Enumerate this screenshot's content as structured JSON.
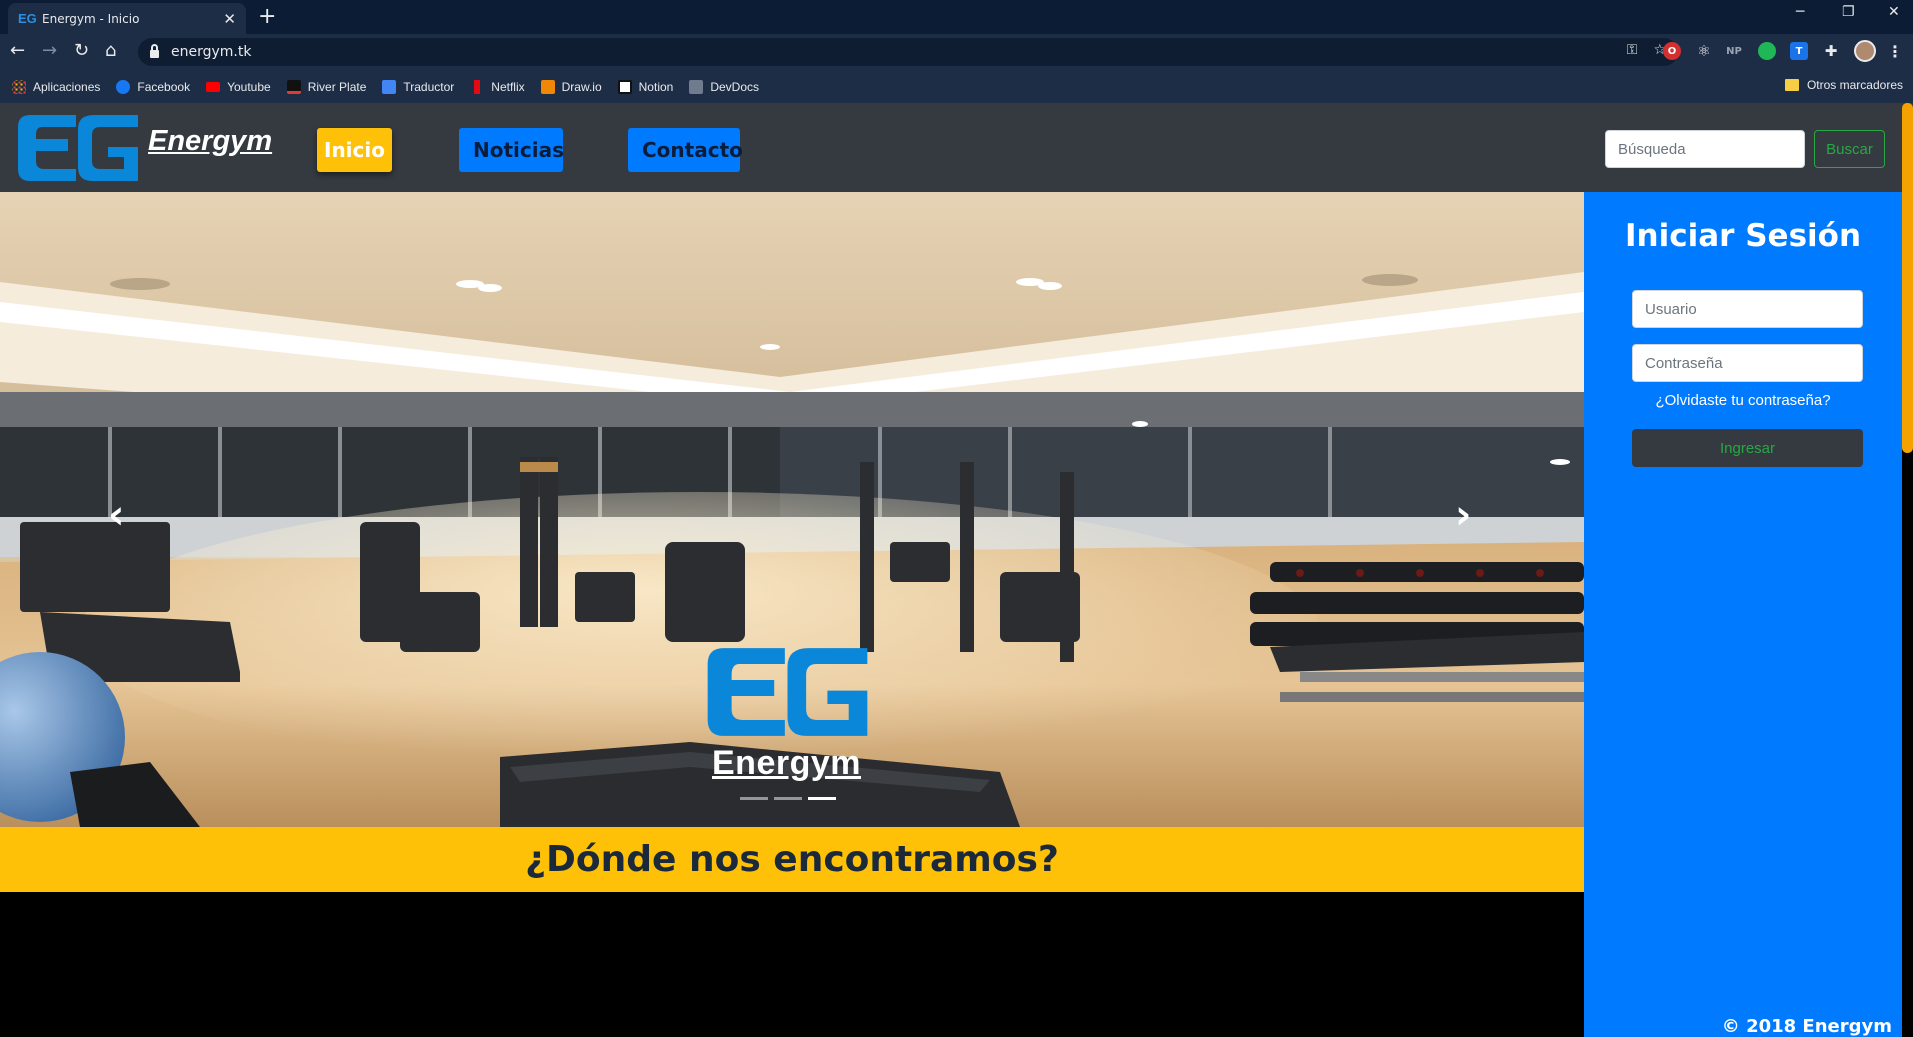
{
  "browser": {
    "tab_title": "Energym - Inicio",
    "tab_favicon": "EG",
    "url": "energym.tk",
    "bookmarks": [
      {
        "label": "Aplicaciones",
        "icon": "apps-grid-icon"
      },
      {
        "label": "Facebook",
        "icon": "facebook-icon"
      },
      {
        "label": "Youtube",
        "icon": "youtube-icon"
      },
      {
        "label": "River Plate",
        "icon": "river-plate-icon"
      },
      {
        "label": "Traductor",
        "icon": "translate-icon"
      },
      {
        "label": "Netflix",
        "icon": "netflix-icon"
      },
      {
        "label": "Draw.io",
        "icon": "drawio-icon"
      },
      {
        "label": "Notion",
        "icon": "notion-icon"
      },
      {
        "label": "DevDocs",
        "icon": "devdocs-icon"
      }
    ],
    "other_bookmarks": "Otros marcadores",
    "extension_np": "NP",
    "extension_t": "T"
  },
  "site": {
    "brand": "Energym",
    "nav": {
      "inicio": "Inicio",
      "noticias": "Noticias",
      "contacto": "Contacto"
    },
    "search": {
      "placeholder": "Búsqueda",
      "button": "Buscar"
    },
    "carousel": {
      "brand": "Energym",
      "slides": 3,
      "active_slide": 3
    },
    "location_title": "¿Dónde nos encontramos?",
    "login": {
      "title": "Iniciar Sesión",
      "user_placeholder": "Usuario",
      "password_placeholder": "Contraseña",
      "forgot": "¿Olvidaste tu contraseña?",
      "submit": "Ingresar"
    },
    "copyright": "© 2018 Energym"
  },
  "colors": {
    "accent_yellow": "#ffc107",
    "primary_blue": "#007bff",
    "nav_dark": "#343a40",
    "success_green": "#28a745",
    "logo_blue": "#0a87d8"
  }
}
